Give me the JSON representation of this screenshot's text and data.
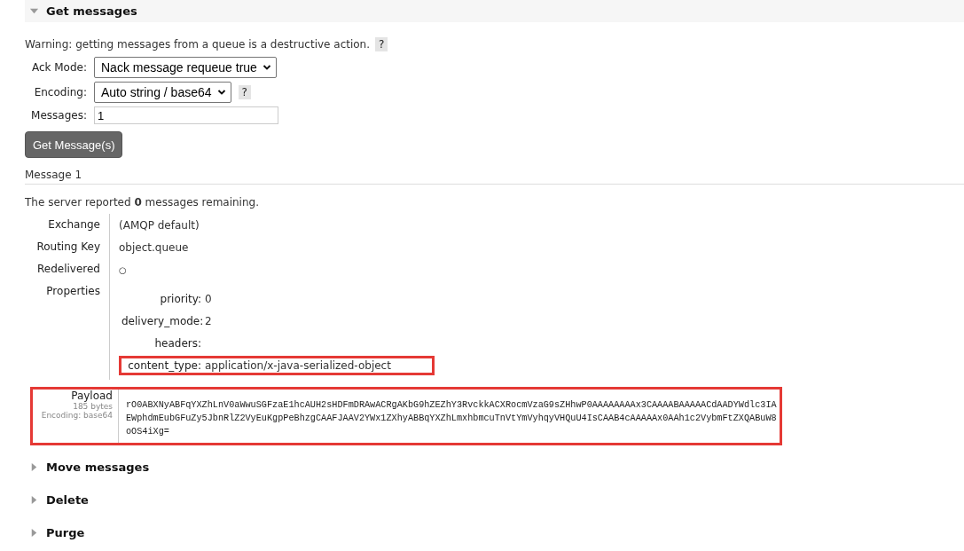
{
  "get_section": {
    "title": "Get messages",
    "expanded": true
  },
  "warning": {
    "text": "Warning: getting messages from a queue is a destructive action.",
    "help": "?"
  },
  "form": [
    {
      "kind": "select",
      "label": "Ack Mode:",
      "value": "Nack message requeue true"
    },
    {
      "kind": "select",
      "label": "Encoding:",
      "value": "Auto string / base64",
      "help": "?"
    },
    {
      "kind": "input",
      "label": "Messages:",
      "value": "1"
    }
  ],
  "get_button": "Get Message(s)",
  "message_title": "Message 1",
  "remaining": "The server reported **0** messages remaining.",
  "details": [
    {
      "kind": "text",
      "label": "Exchange",
      "value": "(AMQP default)"
    },
    {
      "kind": "text",
      "label": "Routing Key",
      "value": "object.queue"
    },
    {
      "kind": "flag",
      "label": "Redelivered",
      "value": "○"
    },
    {
      "kind": "props",
      "label": "Properties",
      "properties": [
        {
          "key": "priority:",
          "value": "0",
          "highlighted": false
        },
        {
          "key": "delivery_mode:",
          "value": "2",
          "highlighted": false
        },
        {
          "key": "headers:",
          "highlighted": false
        },
        {
          "key": "content_type:",
          "value": "application/x-java-serialized-object",
          "highlighted": true
        }
      ]
    }
  ],
  "payload": {
    "label": "Payload",
    "size": "185 bytes",
    "encoding": "Encoding: base64",
    "highlighted": true,
    "lines": [
      "rO0ABXNyABFqYXZhLnV0aWwuSGFzaE1hcAUH2sHDFmDRAwACRgAKbG9hZEZhY3RvckkACXRocmVzaG9sZHhwP0AAAAAAAAx3CAAAABAAAAACdAADYWdlc3IA",
      "EWphdmEubGFuZy5JbnRlZ2VyEuKgpPeBhzgCAAFJAAV2YWx1ZXhyABBqYXZhLmxhbmcuTnVtYmVyhqyVHQuU4IsCAAB4cAAAAAx0AAh1c2VybmFtZXQABuW8",
      "oOS4iXg="
    ]
  },
  "sections": [
    {
      "title": "Move messages",
      "expanded": false
    },
    {
      "title": "Delete",
      "expanded": false
    },
    {
      "title": "Purge",
      "expanded": false
    }
  ]
}
